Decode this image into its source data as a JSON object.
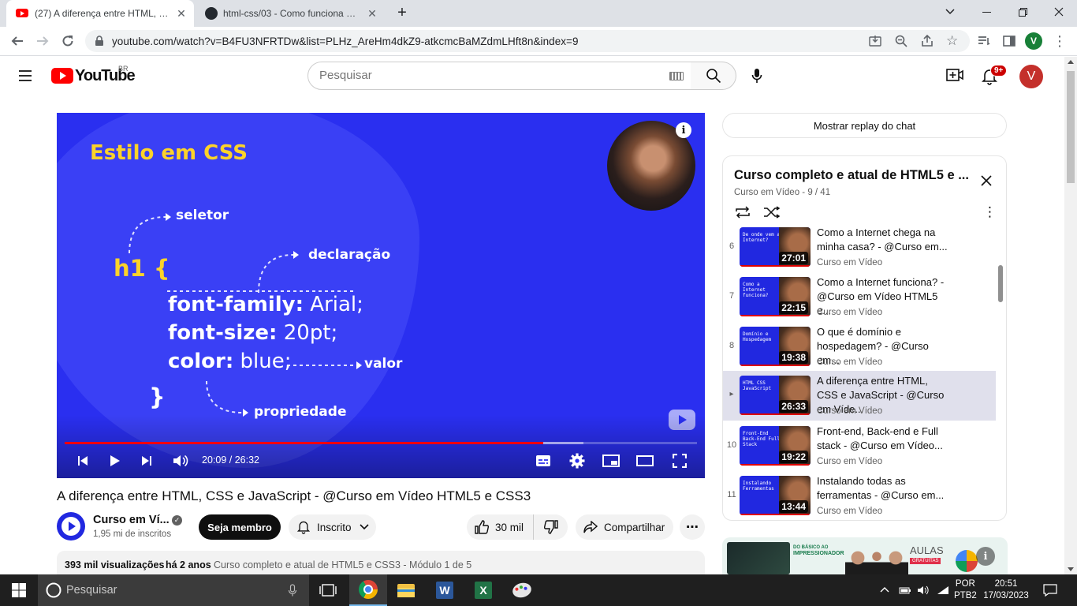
{
  "browser": {
    "tabs": [
      {
        "title": "(27) A diferença entre HTML, CSS"
      },
      {
        "title": "html-css/03 - Como funciona HTI"
      }
    ],
    "url": "youtube.com/watch?v=B4FU3NFRTDw&list=PLHz_AreHm4dkZ9-atkcmcBaMZdmLHft8n&index=9",
    "profile_initial": "V"
  },
  "youtube": {
    "logo_text": "YouTube",
    "region": "BR",
    "search_placeholder": "Pesquisar",
    "notifications_badge": "9+",
    "avatar_initial": "V"
  },
  "video": {
    "slide": {
      "heading": "Estilo em CSS",
      "selector_label": "seletor",
      "declaration_label": "declaração",
      "value_label": "valor",
      "property_label": "propriedade",
      "open_line": "h1 {",
      "line1_prop": "font-family:",
      "line1_val": " Arial;",
      "line2_prop": "font-size:",
      "line2_val": " 20pt;",
      "line3_prop": "color:",
      "line3_val": " blue;",
      "close_line": "}"
    },
    "time": "20:09 / 26:32",
    "progress": 0.757,
    "buffered": 0.82,
    "title": "A diferença entre HTML, CSS e JavaScript - @Curso em Vídeo HTML5 e CSS3",
    "channel": "Curso em Ví...",
    "subscribers": "1,95 mi de inscritos",
    "member_button": "Seja membro",
    "subscribed_button": "Inscrito",
    "likes": "30 mil",
    "share_button": "Compartilhar",
    "views": "393 mil visualizações",
    "published": "há 2 anos",
    "playlist_meta": "Curso completo e atual de HTML5 e CSS3 - Módulo 1 de 5"
  },
  "sidebar": {
    "chat_replay": "Mostrar replay do chat",
    "playlist_title": "Curso completo e atual de HTML5 e ...",
    "playlist_sub": "Curso em Vídeo - 9 / 41",
    "items": [
      {
        "index": "6",
        "title": "Como a Internet chega na minha casa? - @Curso em...",
        "channel": "Curso em Vídeo",
        "duration": "27:01",
        "thumb": "De onde vem a Internet?"
      },
      {
        "index": "7",
        "title": "Como a Internet funciona? - @Curso em Vídeo HTML5 e...",
        "channel": "Curso em Vídeo",
        "duration": "22:15",
        "thumb": "Como a Internet funciona?"
      },
      {
        "index": "8",
        "title": "O que é domínio e hospedagem? - @Curso em...",
        "channel": "Curso em Vídeo",
        "duration": "19:38",
        "thumb": "Domínio e Hospedagem"
      },
      {
        "index": "▸",
        "title": "A diferença entre HTML, CSS e JavaScript - @Curso em Víde...",
        "channel": "Curso em Vídeo",
        "duration": "26:33",
        "thumb": "HTML CSS JavaScript"
      },
      {
        "index": "10",
        "title": "Front-end, Back-end e Full stack - @Curso em Vídeo...",
        "channel": "Curso em Vídeo",
        "duration": "19:22",
        "thumb": "Front-End Back-End Full Stack"
      },
      {
        "index": "11",
        "title": "Instalando todas as ferramentas - @Curso em...",
        "channel": "Curso em Vídeo",
        "duration": "13:44",
        "thumb": "Instalando Ferramentas"
      }
    ],
    "ad": {
      "line1": "DO BÁSICO AO",
      "line2": "IMPRESSIONADOR",
      "badge1": "AULAS",
      "badge2": "GRATUITAS"
    }
  },
  "taskbar": {
    "search_placeholder": "Pesquisar",
    "lang1": "POR",
    "lang2": "PTB2",
    "time": "20:51",
    "date": "17/03/2023"
  },
  "colors": {
    "youtube_red": "#ff0000",
    "player_blue": "#2a2ff0",
    "slide_yellow": "#fcd32a"
  }
}
